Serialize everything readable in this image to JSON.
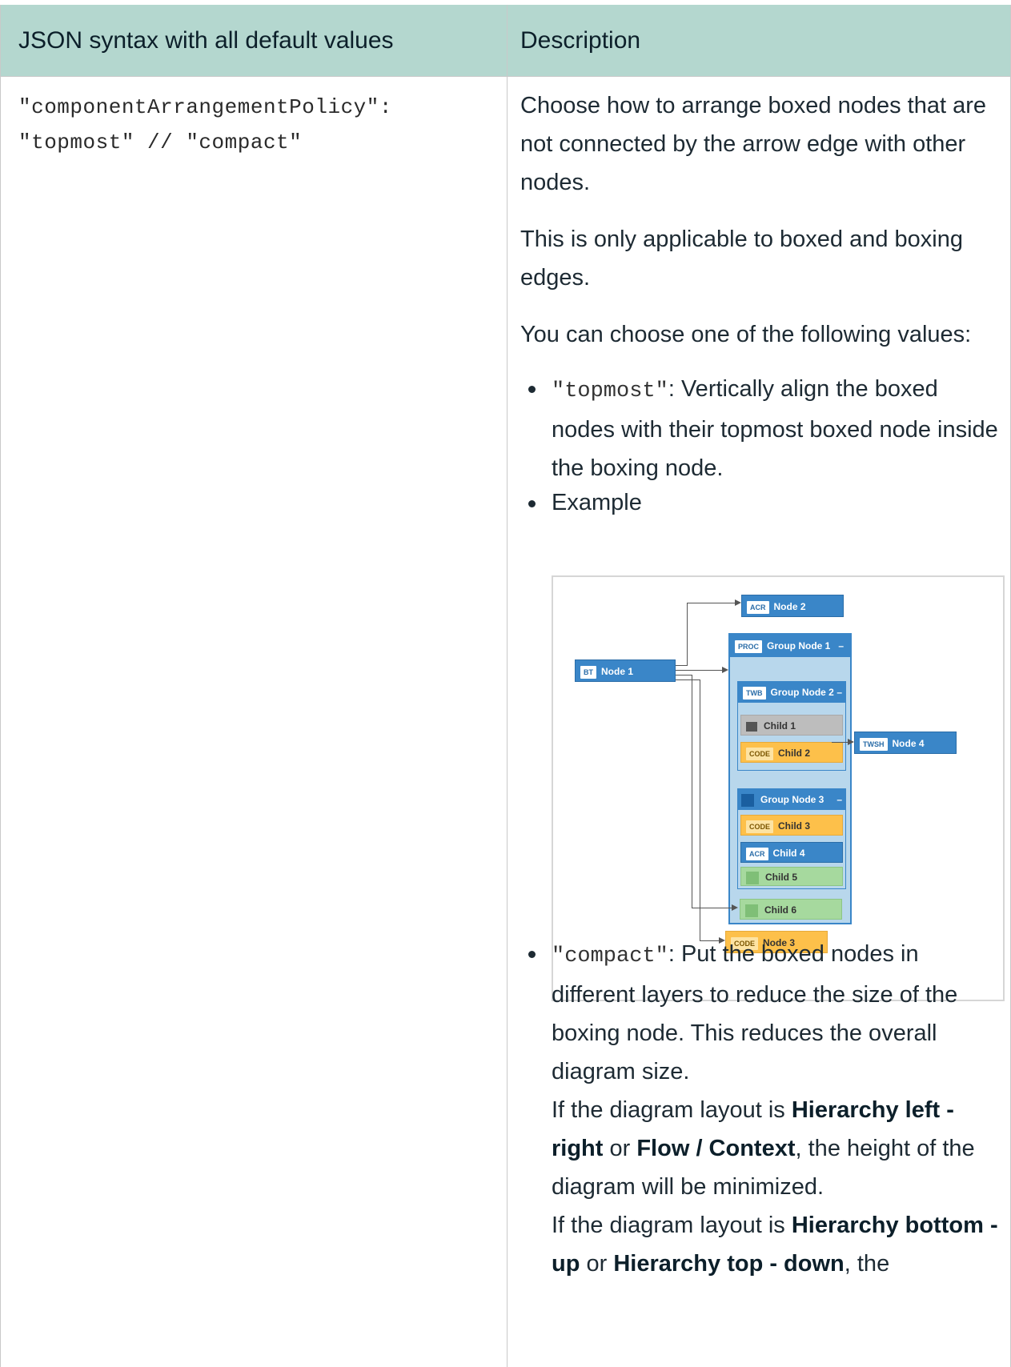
{
  "table": {
    "headers": [
      "JSON syntax with all default values",
      "Description"
    ],
    "code_lines": [
      "\"componentArrangementPolicy\":",
      "\"topmost\" // \"compact\""
    ],
    "paragraphs": [
      "Choose how to arrange boxed nodes that are not connected by the arrow edge with other nodes.",
      "This is only applicable to boxed and boxing edges.",
      "You can choose one of the following values:"
    ],
    "bullets": {
      "topmost_code": "\"topmost\"",
      "topmost_text": ": Vertically align the boxed nodes with their topmost boxed node inside the boxing node.",
      "example_label": "Example",
      "compact_code": "\"compact\"",
      "compact_text": ": Put the boxed nodes in different layers to reduce the size of the boxing node. This reduces the overall diagram size.",
      "compact_l2_a": "If the diagram layout is ",
      "compact_l2_b1": "Hierarchy left - right",
      "compact_l2_or": " or ",
      "compact_l2_b2": "Flow / Context",
      "compact_l2_c": ", the height of the diagram will be minimized.",
      "compact_l3_a": "If the diagram layout is ",
      "compact_l3_b1": "Hierarchy bottom - up",
      "compact_l3_or": " or ",
      "compact_l3_b2": "Hierarchy top - down",
      "compact_l3_c": ", the"
    }
  },
  "diagram": {
    "node2": {
      "tag": "ACR",
      "label": "Node 2"
    },
    "group1": {
      "tag": "PROC",
      "label": "Group Node 1",
      "toggle": "–"
    },
    "node1": {
      "tag": "BT",
      "label": "Node 1"
    },
    "group2": {
      "tag": "TWB",
      "label": "Group Node 2",
      "toggle": "–"
    },
    "child1": {
      "label": "Child 1"
    },
    "child2": {
      "tag": "CODE",
      "label": "Child 2"
    },
    "node4": {
      "tag": "TWSH",
      "label": "Node 4"
    },
    "group3": {
      "label": "Group Node 3",
      "toggle": "–"
    },
    "child3": {
      "tag": "CODE",
      "label": "Child 3"
    },
    "child4": {
      "tag": "ACR",
      "label": "Child 4"
    },
    "child5": {
      "label": "Child 5"
    },
    "child6": {
      "label": "Child 6"
    },
    "node3": {
      "tag": "CODE",
      "label": "Node 3"
    },
    "colors": {
      "blue": "#3a86c8",
      "orange": "#fdc04a",
      "gray": "#bdbdbd",
      "green": "#a6d99e",
      "group_bg": "#b8d7ec"
    }
  }
}
